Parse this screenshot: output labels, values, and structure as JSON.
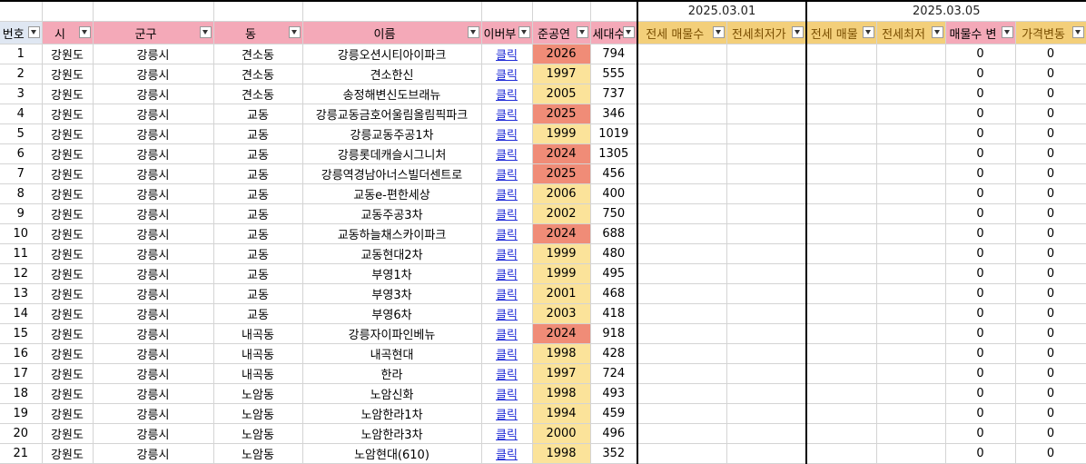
{
  "dates": {
    "date1": "2025.03.01",
    "date2": "2025.03.05"
  },
  "headers": {
    "num": "번호",
    "si": "시",
    "gungu": "군구",
    "dong": "동",
    "name": "이름",
    "ibeobu": "이버부",
    "year": "준공연",
    "households": "세대수",
    "jeonse1": "전세 매물수",
    "jeonsemin1": "전세최저가",
    "jeonse2": "전세 매물",
    "jeonsemin2": "전세최저",
    "change": "매물수 변",
    "price": "가격변동"
  },
  "link_text": "클릭",
  "rows": [
    {
      "n": "1",
      "si": "강원도",
      "gungu": "강릉시",
      "dong": "견소동",
      "name": "강릉오션시티아이파크",
      "year": "2026",
      "hh": "794",
      "change": "0",
      "price": "0"
    },
    {
      "n": "2",
      "si": "강원도",
      "gungu": "강릉시",
      "dong": "견소동",
      "name": "견소한신",
      "year": "1997",
      "hh": "555",
      "change": "0",
      "price": "0"
    },
    {
      "n": "3",
      "si": "강원도",
      "gungu": "강릉시",
      "dong": "견소동",
      "name": "송정해변신도브래뉴",
      "year": "2005",
      "hh": "737",
      "change": "0",
      "price": "0"
    },
    {
      "n": "4",
      "si": "강원도",
      "gungu": "강릉시",
      "dong": "교동",
      "name": "강릉교동금호어울림올림픽파크",
      "year": "2025",
      "hh": "346",
      "change": "0",
      "price": "0"
    },
    {
      "n": "5",
      "si": "강원도",
      "gungu": "강릉시",
      "dong": "교동",
      "name": "강릉교동주공1차",
      "year": "1999",
      "hh": "1019",
      "change": "0",
      "price": "0"
    },
    {
      "n": "6",
      "si": "강원도",
      "gungu": "강릉시",
      "dong": "교동",
      "name": "강릉롯데캐슬시그니처",
      "year": "2024",
      "hh": "1305",
      "change": "0",
      "price": "0"
    },
    {
      "n": "7",
      "si": "강원도",
      "gungu": "강릉시",
      "dong": "교동",
      "name": "강릉역경남아너스빌더센트로",
      "year": "2025",
      "hh": "456",
      "change": "0",
      "price": "0"
    },
    {
      "n": "8",
      "si": "강원도",
      "gungu": "강릉시",
      "dong": "교동",
      "name": "교동e-편한세상",
      "year": "2006",
      "hh": "400",
      "change": "0",
      "price": "0"
    },
    {
      "n": "9",
      "si": "강원도",
      "gungu": "강릉시",
      "dong": "교동",
      "name": "교동주공3차",
      "year": "2002",
      "hh": "750",
      "change": "0",
      "price": "0"
    },
    {
      "n": "10",
      "si": "강원도",
      "gungu": "강릉시",
      "dong": "교동",
      "name": "교동하늘채스카이파크",
      "year": "2024",
      "hh": "688",
      "change": "0",
      "price": "0"
    },
    {
      "n": "11",
      "si": "강원도",
      "gungu": "강릉시",
      "dong": "교동",
      "name": "교동현대2차",
      "year": "1999",
      "hh": "480",
      "change": "0",
      "price": "0"
    },
    {
      "n": "12",
      "si": "강원도",
      "gungu": "강릉시",
      "dong": "교동",
      "name": "부영1차",
      "year": "1999",
      "hh": "495",
      "change": "0",
      "price": "0"
    },
    {
      "n": "13",
      "si": "강원도",
      "gungu": "강릉시",
      "dong": "교동",
      "name": "부영3차",
      "year": "2001",
      "hh": "468",
      "change": "0",
      "price": "0"
    },
    {
      "n": "14",
      "si": "강원도",
      "gungu": "강릉시",
      "dong": "교동",
      "name": "부영6차",
      "year": "2003",
      "hh": "418",
      "change": "0",
      "price": "0"
    },
    {
      "n": "15",
      "si": "강원도",
      "gungu": "강릉시",
      "dong": "내곡동",
      "name": "강릉자이파인베뉴",
      "year": "2024",
      "hh": "918",
      "change": "0",
      "price": "0"
    },
    {
      "n": "16",
      "si": "강원도",
      "gungu": "강릉시",
      "dong": "내곡동",
      "name": "내곡현대",
      "year": "1998",
      "hh": "428",
      "change": "0",
      "price": "0"
    },
    {
      "n": "17",
      "si": "강원도",
      "gungu": "강릉시",
      "dong": "내곡동",
      "name": "한라",
      "year": "1997",
      "hh": "724",
      "change": "0",
      "price": "0"
    },
    {
      "n": "18",
      "si": "강원도",
      "gungu": "강릉시",
      "dong": "노암동",
      "name": "노암신화",
      "year": "1998",
      "hh": "493",
      "change": "0",
      "price": "0"
    },
    {
      "n": "19",
      "si": "강원도",
      "gungu": "강릉시",
      "dong": "노암동",
      "name": "노암한라1차",
      "year": "1994",
      "hh": "459",
      "change": "0",
      "price": "0"
    },
    {
      "n": "20",
      "si": "강원도",
      "gungu": "강릉시",
      "dong": "노암동",
      "name": "노암한라3차",
      "year": "2000",
      "hh": "496",
      "change": "0",
      "price": "0"
    },
    {
      "n": "21",
      "si": "강원도",
      "gungu": "강릉시",
      "dong": "노암동",
      "name": "노암현대(610)",
      "year": "1998",
      "hh": "352",
      "change": "0",
      "price": "0"
    }
  ],
  "colors": {
    "header_pink": "#f4a9b8",
    "header_gold": "#f3cf7a",
    "year_yellow": "#fbe39a",
    "year_red": "#f08c77",
    "link": "#1f2bd6"
  }
}
